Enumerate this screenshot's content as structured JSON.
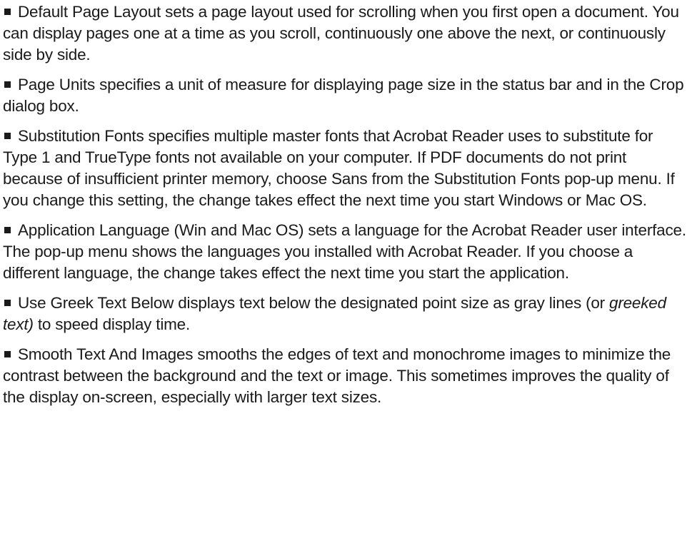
{
  "paragraphs": [
    {
      "text": "Default Page Layout sets a page layout used for scrolling when you first open a document. You can display pages one at a time as you scroll, continuously one above the next, or continuously side by side."
    },
    {
      "text": "Page Units specifies a unit of measure for displaying page size in the status bar and in the Crop dialog box."
    },
    {
      "text": "Substitution Fonts specifies multiple master fonts that Acrobat Reader uses to substitute for Type 1 and TrueType fonts not available on your computer. If PDF documents do not print because of insufficient printer memory, choose Sans from the Substitution Fonts pop-up menu. If you change this setting, the change takes effect the next time you start Windows or Mac OS."
    },
    {
      "text": "Application Language (Win and Mac OS) sets a language for the Acrobat Reader user interface. The pop-up menu shows the languages you installed with Acrobat Reader. If you choose a different language, the change takes effect the next time you start the application."
    },
    {
      "text_before": "Use Greek Text Below displays text below the designated point size as gray lines (or ",
      "text_italic": "greeked text)",
      "text_after": " to speed display time."
    },
    {
      "text": "Smooth Text And Images smooths the edges of text and monochrome images to minimize the contrast between the background and the text or image. This sometimes improves the quality of the display on-screen, especially with larger text sizes."
    }
  ]
}
